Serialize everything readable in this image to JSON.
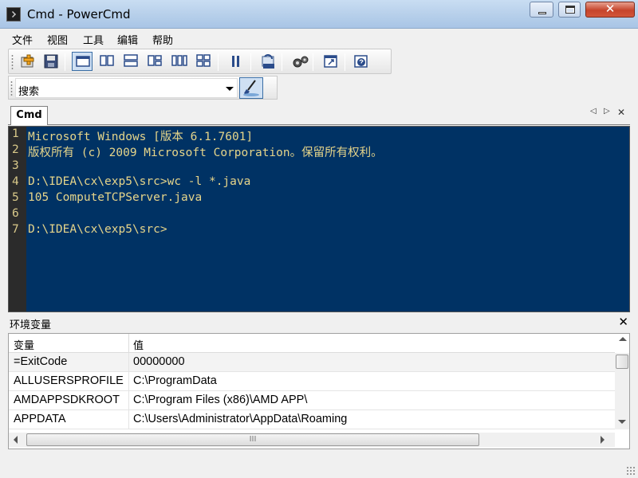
{
  "window": {
    "title": "Cmd - PowerCmd",
    "close_glyph": "✕"
  },
  "menu": {
    "items": [
      "文件",
      "视图",
      "工具",
      "编辑",
      "帮助"
    ]
  },
  "toolbar": {
    "icons": [
      "new-tab-icon",
      "save-icon",
      "single-pane-icon",
      "two-columns-icon",
      "two-rows-icon",
      "three-pane-icon",
      "three-columns-icon",
      "four-pane-icon",
      "pause-icon",
      "log-icon",
      "settings-icon",
      "open-window-icon",
      "help-icon"
    ]
  },
  "search": {
    "value": "搜索"
  },
  "tabs": [
    {
      "label": "Cmd"
    }
  ],
  "console": {
    "lines": [
      {
        "n": "1",
        "text": "Microsoft Windows [版本 6.1.7601]"
      },
      {
        "n": "2",
        "text": "版权所有 (c) 2009 Microsoft Corporation。保留所有权利。"
      },
      {
        "n": "3",
        "text": ""
      },
      {
        "n": "4",
        "text": "D:\\IDEA\\cx\\exp5\\src>wc -l *.java"
      },
      {
        "n": "5",
        "text": "105 ComputeTCPServer.java"
      },
      {
        "n": "6",
        "text": ""
      },
      {
        "n": "7",
        "text": "D:\\IDEA\\cx\\exp5\\src>"
      }
    ],
    "bg_color": "#003264",
    "text_color": "#e6d58a"
  },
  "env_panel": {
    "title": "环境变量",
    "close_glyph": "✕",
    "columns": [
      "变量",
      "值"
    ],
    "rows": [
      {
        "name": "=ExitCode",
        "value": "00000000"
      },
      {
        "name": "ALLUSERSPROFILE",
        "value": "C:\\ProgramData"
      },
      {
        "name": "AMDAPPSDKROOT",
        "value": "C:\\Program Files (x86)\\AMD APP\\"
      },
      {
        "name": "APPDATA",
        "value": "C:\\Users\\Administrator\\AppData\\Roaming"
      }
    ],
    "hscroll_glyph": "III"
  }
}
